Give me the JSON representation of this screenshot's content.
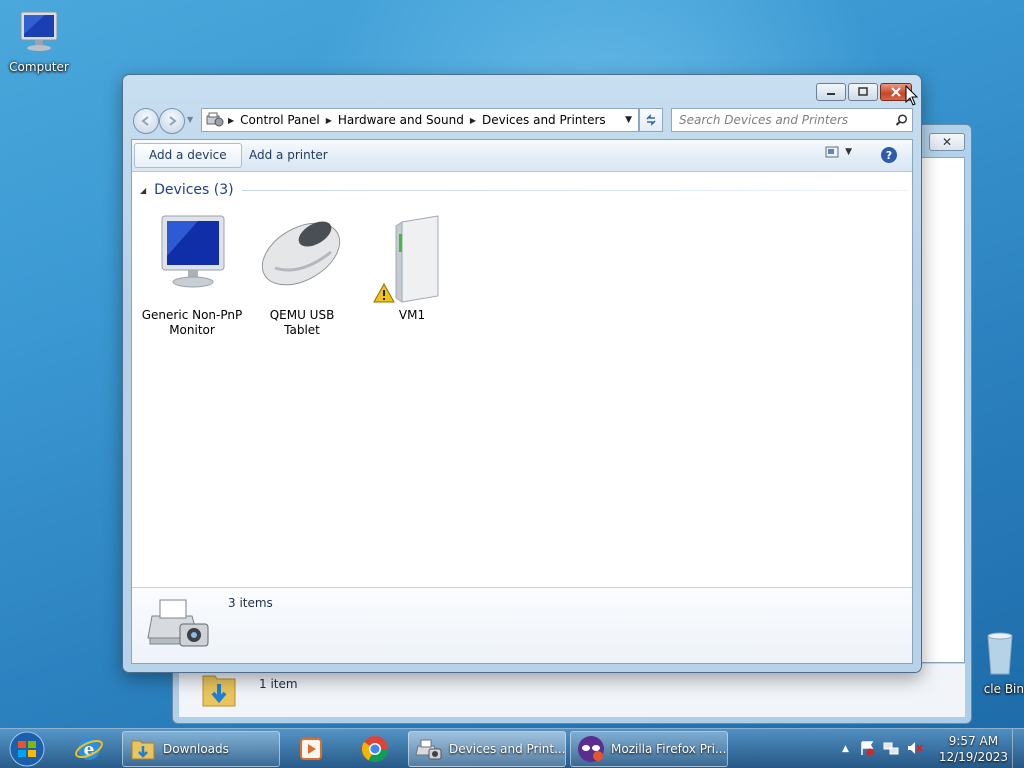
{
  "desktop": {
    "computer_label": "Computer",
    "recycle_label": "cle Bin"
  },
  "bg_window": {
    "close_glyph": "✕",
    "items_count": "1 item"
  },
  "window": {
    "caption": {
      "minimize": "minimize",
      "maximize": "maximize",
      "close": "close"
    },
    "address": {
      "segments": [
        "Control Panel",
        "Hardware and Sound",
        "Devices and Printers"
      ]
    },
    "search": {
      "placeholder": "Search Devices and Printers"
    },
    "toolbar": {
      "add_device": "Add a device",
      "add_printer": "Add a printer"
    },
    "group": {
      "title": "Devices (3)"
    },
    "devices": [
      {
        "label_line1": "Generic Non-PnP",
        "label_line2": "Monitor",
        "icon": "monitor-icon"
      },
      {
        "label_line1": "QEMU USB",
        "label_line2": "Tablet",
        "icon": "mouse-icon"
      },
      {
        "label_line1": "VM1",
        "label_line2": "",
        "icon": "computer-tower-icon",
        "warning": true
      }
    ],
    "details": {
      "count": "3 items"
    }
  },
  "taskbar": {
    "tasks": [
      {
        "label": "Downloads"
      },
      {
        "label": "Devices and Print..."
      },
      {
        "label": "Mozilla Firefox Pri..."
      }
    ],
    "clock": {
      "time": "9:57 AM",
      "date": "12/19/2023"
    }
  },
  "colors": {
    "desktop_bg": "#3b98d2",
    "group_title": "#1e3f8a",
    "close_button": "#c8442a"
  }
}
